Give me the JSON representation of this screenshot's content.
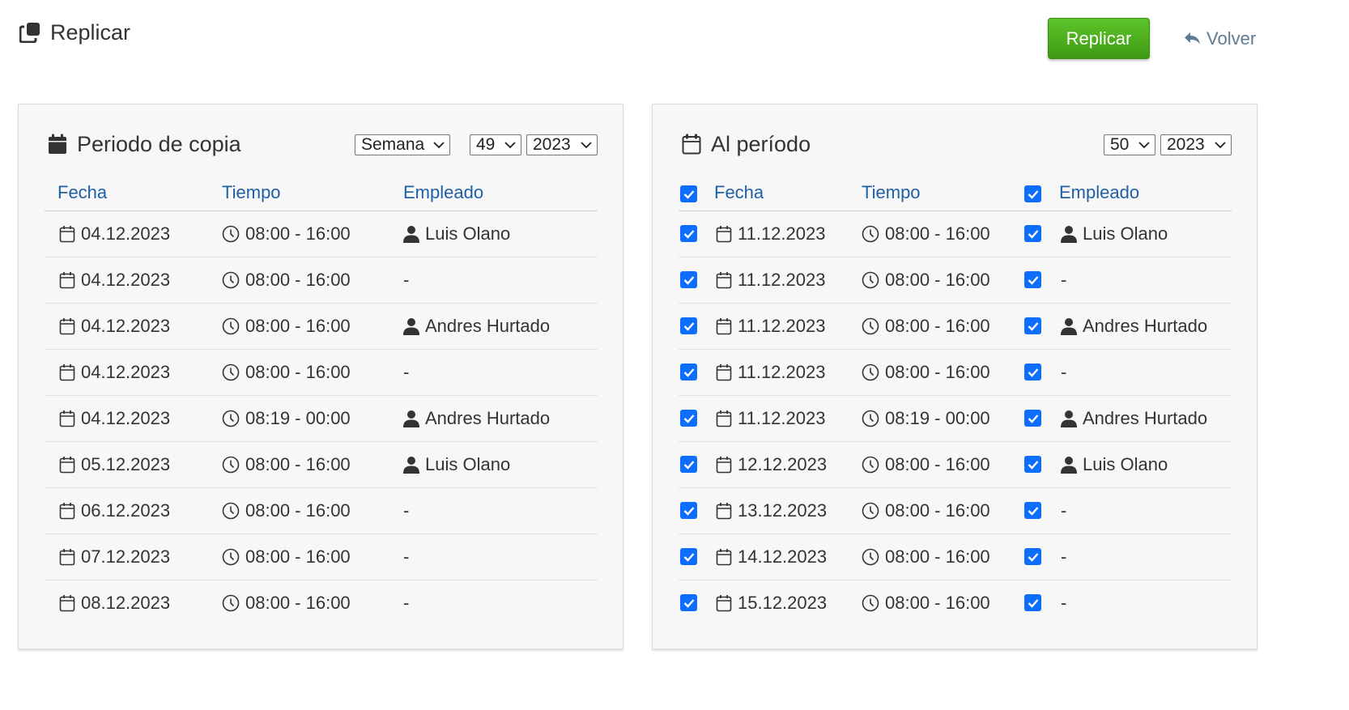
{
  "header": {
    "title": "Replicar",
    "icon": "copy-icon"
  },
  "actions": {
    "replicar_label": "Replicar",
    "volver_label": "Volver"
  },
  "colors": {
    "accent_green": "#4fb01e",
    "link_blue": "#1f5fa6",
    "checkbox_blue": "#0d6efd",
    "volver_gray": "#5f7a92"
  },
  "source": {
    "title": "Periodo de copia",
    "period_type": "Semana",
    "week": "49",
    "year": "2023",
    "columns": {
      "date": "Fecha",
      "time": "Tiempo",
      "employee": "Empleado"
    },
    "rows": [
      {
        "date": "04.12.2023",
        "time": "08:00 - 16:00",
        "employee": "Luis Olano"
      },
      {
        "date": "04.12.2023",
        "time": "08:00 - 16:00",
        "employee": "-"
      },
      {
        "date": "04.12.2023",
        "time": "08:00 - 16:00",
        "employee": "Andres Hurtado"
      },
      {
        "date": "04.12.2023",
        "time": "08:00 - 16:00",
        "employee": "-"
      },
      {
        "date": "04.12.2023",
        "time": "08:19 - 00:00",
        "employee": "Andres Hurtado"
      },
      {
        "date": "05.12.2023",
        "time": "08:00 - 16:00",
        "employee": "Luis Olano"
      },
      {
        "date": "06.12.2023",
        "time": "08:00 - 16:00",
        "employee": "-"
      },
      {
        "date": "07.12.2023",
        "time": "08:00 - 16:00",
        "employee": "-"
      },
      {
        "date": "08.12.2023",
        "time": "08:00 - 16:00",
        "employee": "-"
      }
    ]
  },
  "target": {
    "title": "Al período",
    "week": "50",
    "year": "2023",
    "columns": {
      "date": "Fecha",
      "time": "Tiempo",
      "employee": "Empleado"
    },
    "select_all_dates": true,
    "select_all_employees": true,
    "rows": [
      {
        "date": "11.12.2023",
        "time": "08:00 - 16:00",
        "employee": "Luis Olano",
        "date_checked": true,
        "employee_checked": true
      },
      {
        "date": "11.12.2023",
        "time": "08:00 - 16:00",
        "employee": "-",
        "date_checked": true,
        "employee_checked": true
      },
      {
        "date": "11.12.2023",
        "time": "08:00 - 16:00",
        "employee": "Andres Hurtado",
        "date_checked": true,
        "employee_checked": true
      },
      {
        "date": "11.12.2023",
        "time": "08:00 - 16:00",
        "employee": "-",
        "date_checked": true,
        "employee_checked": true
      },
      {
        "date": "11.12.2023",
        "time": "08:19 - 00:00",
        "employee": "Andres Hurtado",
        "date_checked": true,
        "employee_checked": true
      },
      {
        "date": "12.12.2023",
        "time": "08:00 - 16:00",
        "employee": "Luis Olano",
        "date_checked": true,
        "employee_checked": true
      },
      {
        "date": "13.12.2023",
        "time": "08:00 - 16:00",
        "employee": "-",
        "date_checked": true,
        "employee_checked": true
      },
      {
        "date": "14.12.2023",
        "time": "08:00 - 16:00",
        "employee": "-",
        "date_checked": true,
        "employee_checked": true
      },
      {
        "date": "15.12.2023",
        "time": "08:00 - 16:00",
        "employee": "-",
        "date_checked": true,
        "employee_checked": true
      }
    ]
  }
}
